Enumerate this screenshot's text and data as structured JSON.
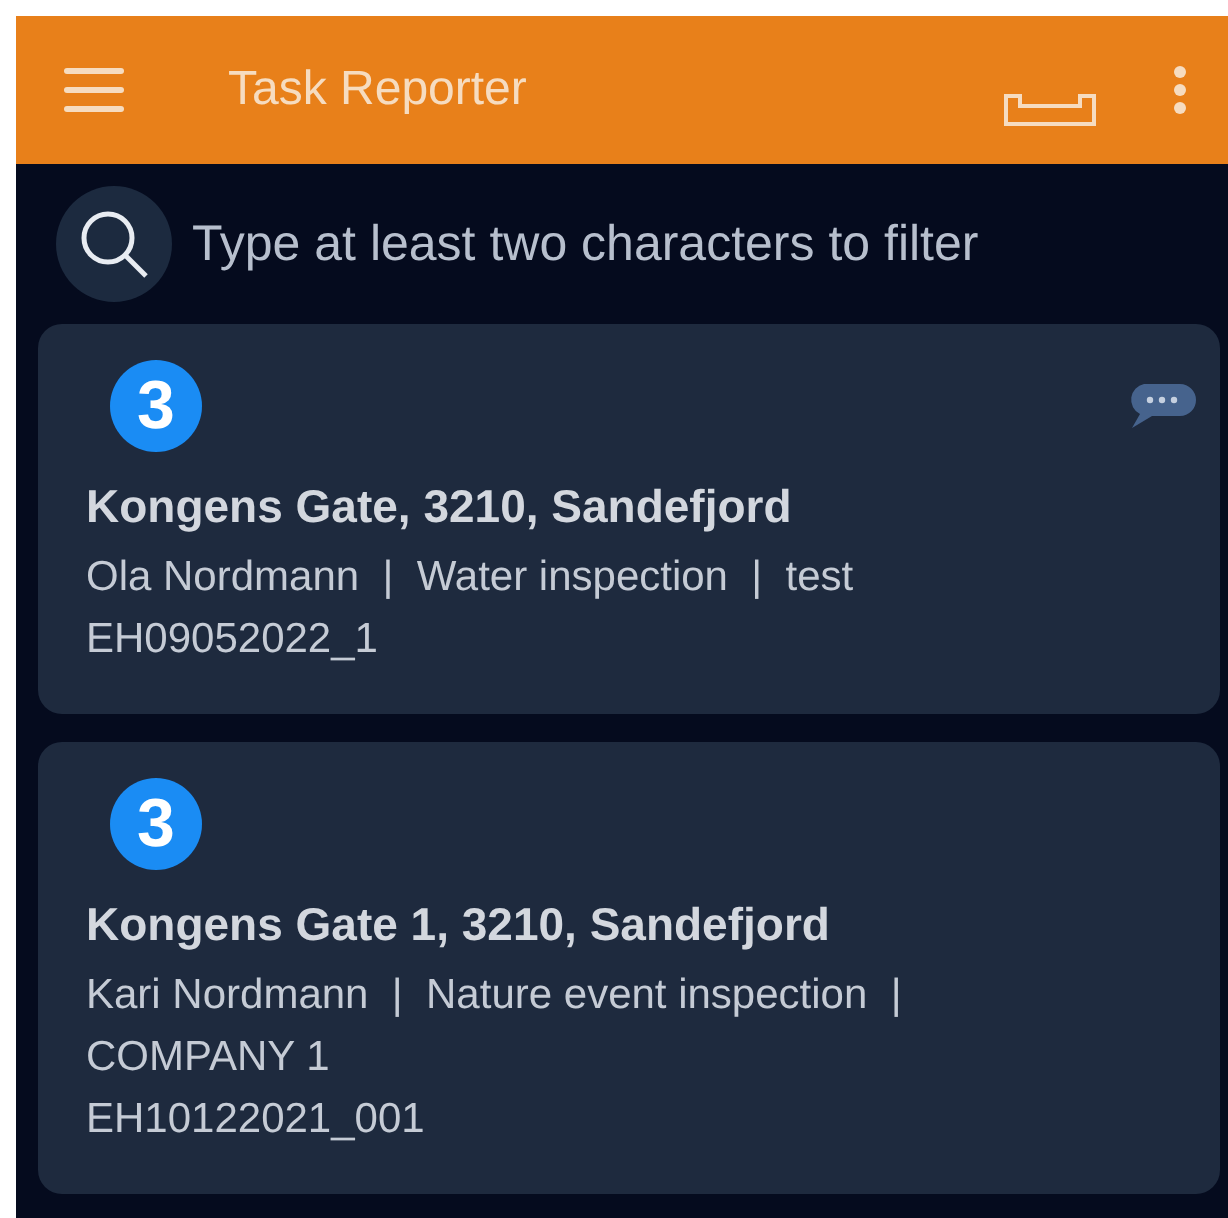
{
  "app_bar": {
    "title": "Task Reporter"
  },
  "search": {
    "placeholder": "Type at least two characters to filter"
  },
  "tasks": [
    {
      "badge": "3",
      "has_comment": true,
      "address": "Kongens Gate, 3210, Sandefjord",
      "details": "Ola Nordmann  |  Water inspection  |  test",
      "code": "EH09052022_1"
    },
    {
      "badge": "3",
      "has_comment": false,
      "address": "Kongens Gate 1, 3210, Sandefjord",
      "details": "Kari Nordmann  |  Nature event inspection  |  COMPANY 1",
      "code": "EH10122021_001"
    }
  ]
}
